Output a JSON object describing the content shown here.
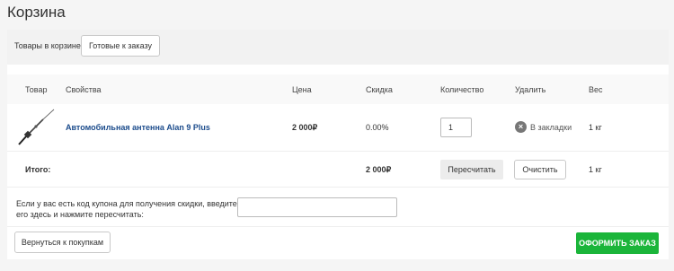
{
  "page": {
    "title": "Корзина"
  },
  "tabs": {
    "label": "Товары в корзине:",
    "ready_button": "Готовые к заказу"
  },
  "columns": {
    "product": "Товар",
    "properties": "Свойства",
    "price": "Цена",
    "discount": "Скидка",
    "quantity": "Количество",
    "delete": "Удалить",
    "weight": "Вес"
  },
  "items": [
    {
      "name": "Автомобильная антенна Alan 9 Plus",
      "price": "2 000₽",
      "discount": "0.00%",
      "quantity": "1",
      "bookmark_label": "В закладки",
      "weight": "1 кг",
      "image_icon": "antenna-icon"
    }
  ],
  "totals": {
    "label": "Итого:",
    "price": "2 000₽",
    "recalculate_button": "Пересчитать",
    "clear_button": "Очистить",
    "weight": "1 кг"
  },
  "coupon": {
    "text": "Если у вас есть код купона для получения скидки, введите его здесь и нажмите пересчитать:",
    "value": ""
  },
  "actions": {
    "back_button": "Вернуться к покупкам",
    "order_button": "ОФОРМИТЬ ЗАКАЗ"
  },
  "colors": {
    "accent_green": "#1bb53a",
    "link_blue": "#1c4c8c",
    "background": "#f5f5f5"
  }
}
